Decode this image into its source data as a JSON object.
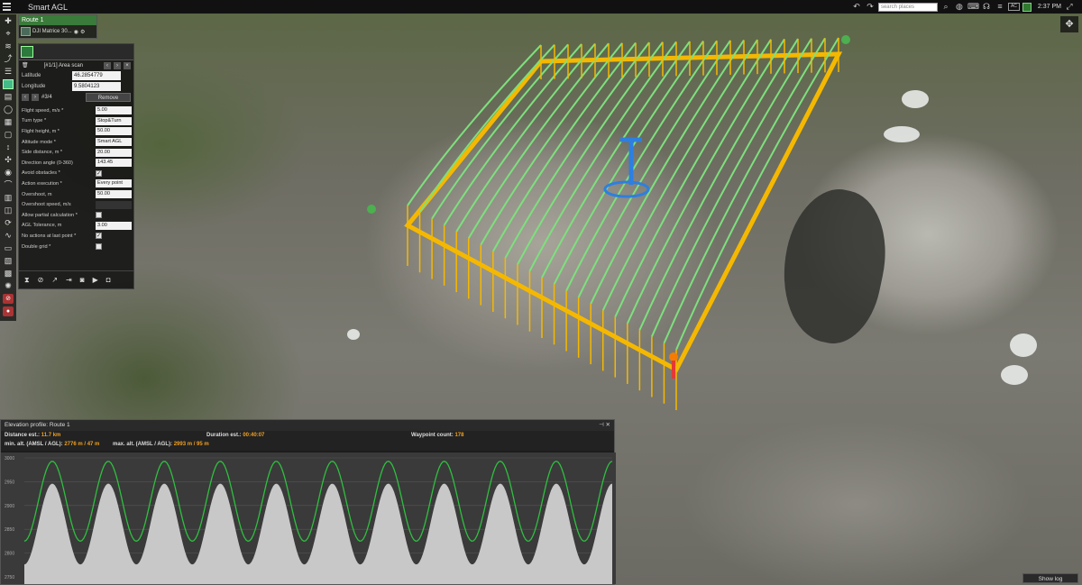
{
  "app": {
    "title": "Smart AGL"
  },
  "topbar": {
    "search_placeholder": "search places",
    "ac_label": "AC",
    "time": "2:37 PM"
  },
  "route": {
    "name": "Route 1",
    "drone": "DJI Matrice 30..."
  },
  "waypoint": {
    "title": "[#1/1] Area scan",
    "latitude_label": "Latitude",
    "latitude": "46.2854779",
    "longitude_label": "Longitude",
    "longitude": "9.5804123",
    "index": "#3/4",
    "remove_label": "Remove"
  },
  "params": [
    {
      "label": "Flight speed, m/s *",
      "value": "5.00"
    },
    {
      "label": "Turn type *",
      "value": "Stop&Turn"
    },
    {
      "label": "Flight height, m *",
      "value": "50.00"
    },
    {
      "label": "Altitude mode *",
      "value": "Smart AGL"
    },
    {
      "label": "Side distance, m *",
      "value": "20.00"
    },
    {
      "label": "Direction angle (0-360)",
      "value": "143.45"
    },
    {
      "label": "Avoid obstacles *",
      "value": "✓"
    },
    {
      "label": "Action execution *",
      "value": "Every point"
    },
    {
      "label": "Overshoot, m",
      "value": "50.00"
    },
    {
      "label": "Overshoot speed, m/s",
      "value": ""
    },
    {
      "label": "Allow partial calculation *",
      "value": ""
    },
    {
      "label": "AGL Tolerance, m",
      "value": "3.00"
    },
    {
      "label": "No actions at last point *",
      "value": "✓"
    },
    {
      "label": "Double grid *",
      "value": ""
    }
  ],
  "elevation": {
    "title": "Elevation profile: Route 1",
    "distance_label": "Distance est.:",
    "distance": "11.7 km",
    "duration_label": "Duration est.:",
    "duration": "00:40:07",
    "waypoints_label": "Waypoint count:",
    "waypoints": "178",
    "min_label": "min. alt. (AMSL / AGL):",
    "min": "2776 m / 47 m",
    "max_label": "max. alt. (AMSL / AGL):",
    "max": "2993 m / 95 m",
    "y_ticks": [
      "3000",
      "2950",
      "2900",
      "2850",
      "2800",
      "2750"
    ],
    "colors": {
      "route": "#2fbf3f",
      "terrain": "#c8c8c8"
    }
  },
  "showlog": "Show log",
  "colors": {
    "flight_path": "#7de07d",
    "boundary": "#f5b800",
    "accent_green": "#2c7a3c"
  }
}
